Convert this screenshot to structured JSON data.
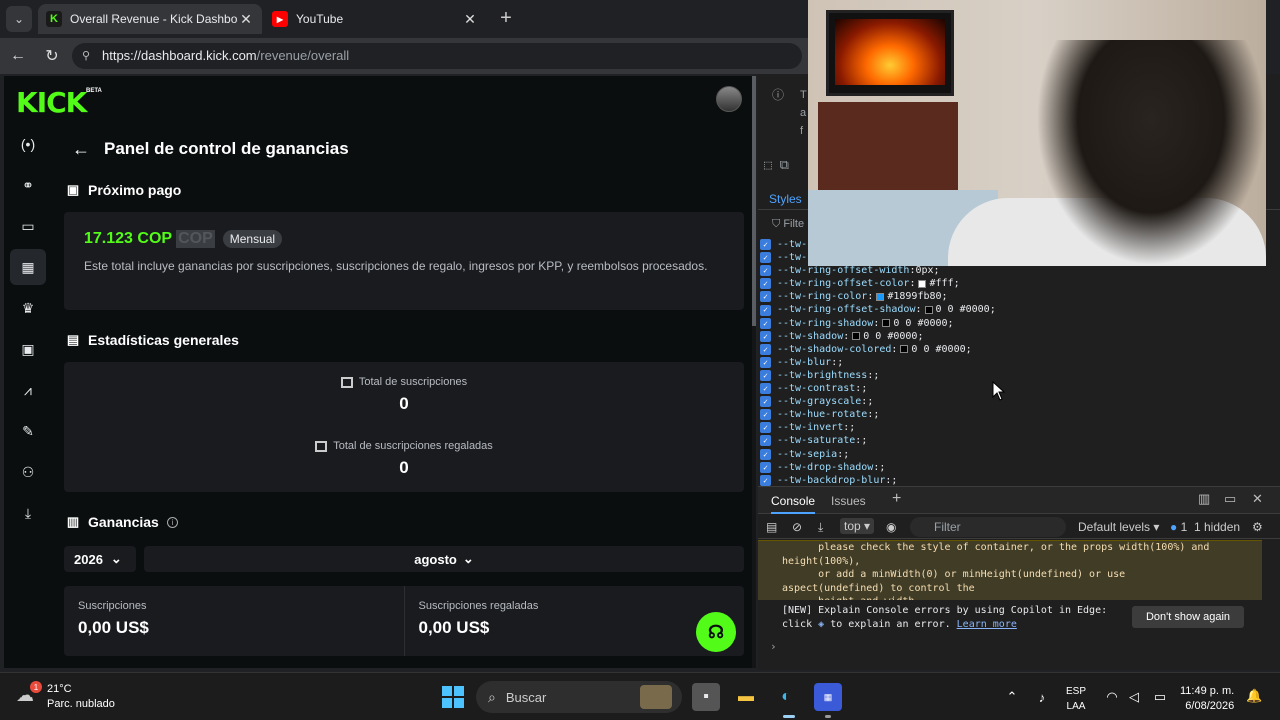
{
  "browser": {
    "tabs": [
      {
        "title": "Overall Revenue - Kick Dashboard",
        "favicon": "kick-icon",
        "active": true
      },
      {
        "title": "YouTube",
        "favicon": "youtube-icon",
        "active": false
      }
    ],
    "url_prefix": "https://",
    "url_host": "dashboard.kick.com",
    "url_path": "/revenue/overall"
  },
  "app": {
    "logo": "KICK",
    "beta": "BETA",
    "page_title": "Panel de control de ganancias",
    "sidebar": [
      {
        "name": "live-icon",
        "glyph": "(•)"
      },
      {
        "name": "link-icon",
        "glyph": "⚭"
      },
      {
        "name": "window-icon",
        "glyph": "▭"
      },
      {
        "name": "chart-icon",
        "glyph": "▦",
        "active": true
      },
      {
        "name": "trophy-icon",
        "glyph": "♛"
      },
      {
        "name": "video-icon",
        "glyph": "▣"
      },
      {
        "name": "analytics-icon",
        "glyph": "⩘"
      },
      {
        "name": "wrench-icon",
        "glyph": "✎"
      },
      {
        "name": "users-icon",
        "glyph": "⚇"
      },
      {
        "name": "download-icon",
        "glyph": "⤓"
      }
    ],
    "next_payment": {
      "heading": "Próximo pago",
      "amount": "17.123 COP",
      "currency_tag": "COP",
      "frequency_badge": "Mensual",
      "description": "Este total incluye ganancias por suscripciones, suscripciones de regalo, ingresos por KPP, y reembolsos procesados."
    },
    "general_stats": {
      "heading": "Estadísticas generales",
      "items": [
        {
          "label": "Total de suscripciones",
          "value": "0"
        },
        {
          "label": "Total de suscripciones regaladas",
          "value": "0"
        }
      ]
    },
    "earnings": {
      "heading": "Ganancias",
      "year": "2026",
      "month": "agosto",
      "cards": [
        {
          "label": "Suscripciones",
          "value": "0,00 US$"
        },
        {
          "label": "Suscripciones regaladas",
          "value": "0,00 US$"
        }
      ]
    },
    "accent_color": "#53fc18"
  },
  "devtools": {
    "info_lines": [
      "T",
      "a",
      "f"
    ],
    "panel_tab": "Styles",
    "filter_placeholder": "Filte",
    "css_lines": [
      {
        "prop": "--tw-",
        "val": ""
      },
      {
        "prop": "--tw-",
        "val": ""
      },
      {
        "prop": "--tw-ring-offset-width",
        "val": "0px;"
      },
      {
        "prop": "--tw-ring-offset-color",
        "val": "#fff;",
        "swatch": "#ffffff"
      },
      {
        "prop": "--tw-ring-color",
        "val": "#1899fb80;",
        "swatch": "#1899fb"
      },
      {
        "prop": "--tw-ring-offset-shadow",
        "val": "0 0 #0000;",
        "swatch": "#000000"
      },
      {
        "prop": "--tw-ring-shadow",
        "val": "0 0 #0000;",
        "swatch": "#000000"
      },
      {
        "prop": "--tw-shadow",
        "val": "0 0 #0000;",
        "swatch": "#000000"
      },
      {
        "prop": "--tw-shadow-colored",
        "val": "0 0 #0000;",
        "swatch": "#000000"
      },
      {
        "prop": "--tw-blur",
        "val": " ;"
      },
      {
        "prop": "--tw-brightness",
        "val": " ;"
      },
      {
        "prop": "--tw-contrast",
        "val": " ;"
      },
      {
        "prop": "--tw-grayscale",
        "val": " ;"
      },
      {
        "prop": "--tw-hue-rotate",
        "val": " ;"
      },
      {
        "prop": "--tw-invert",
        "val": " ;"
      },
      {
        "prop": "--tw-saturate",
        "val": " ;"
      },
      {
        "prop": "--tw-sepia",
        "val": " ;"
      },
      {
        "prop": "--tw-drop-shadow",
        "val": " ;"
      },
      {
        "prop": "--tw-backdrop-blur",
        "val": " ;"
      }
    ],
    "drawer_tabs": [
      "Console",
      "Issues"
    ],
    "console_context": "top",
    "console_filter": "Filter",
    "levels": "Default levels",
    "issue_count": "1",
    "hidden_label": "1 hidden",
    "warning_text": "      please check the style of container, or the props width(100%) and\nheight(100%),\n      or add a minWidth(0) or minHeight(undefined) or use\naspect(undefined) to control the\n      height and width.",
    "new_msg_prefix": "[NEW] Explain Console errors by using Copilot in Edge: click",
    "new_msg_suffix": "to explain an error.",
    "learn_more": "Learn more",
    "dont_show": "Don't show again"
  },
  "taskbar": {
    "temperature": "21°C",
    "weather": "Parc. nublado",
    "weather_badge": "1",
    "search_label": "Buscar",
    "lang_top": "ESP",
    "lang_bottom": "LAA",
    "time": "11:49 p. m.",
    "date": "6/08/2026"
  }
}
